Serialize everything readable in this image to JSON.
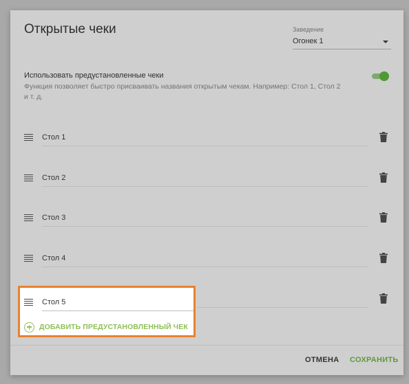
{
  "dialog": {
    "title": "Открытые чеки"
  },
  "venue": {
    "label": "Заведение",
    "value": "Огонек 1"
  },
  "presets": {
    "title": "Использовать предустановленные чеки",
    "description": "Функция позволяет быстро присваивать названия открытым чекам. Например: Стол 1, Стол 2 и т. д.",
    "enabled": true
  },
  "checks": [
    {
      "name": "Стол 1"
    },
    {
      "name": "Стол 2"
    },
    {
      "name": "Стол 3"
    },
    {
      "name": "Стол 4"
    },
    {
      "name": "Стол 5"
    }
  ],
  "add_button": {
    "label": "ДОБАВИТЬ ПРЕДУСТАНОВЛЕННЫЙ ЧЕК"
  },
  "footer": {
    "cancel_label": "ОТМЕНА",
    "save_label": "СОХРАНИТЬ"
  },
  "colors": {
    "accent_green": "#5e9a3a",
    "highlight_orange": "#e8812f"
  },
  "icons": {
    "drag": "drag-handle-icon",
    "delete": "trash-icon",
    "add": "add-circle-icon",
    "dropdown": "caret-down-icon"
  }
}
